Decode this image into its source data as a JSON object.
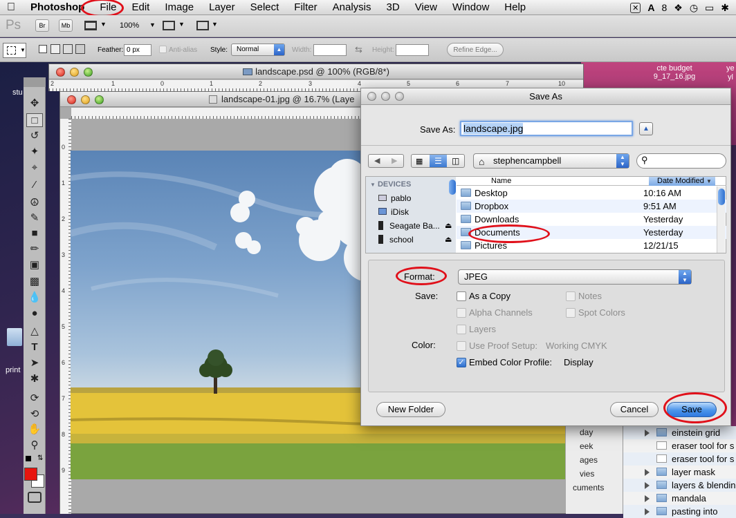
{
  "menubar": {
    "app": "Photoshop",
    "items": [
      "File",
      "Edit",
      "Image",
      "Layer",
      "Select",
      "Filter",
      "Analysis",
      "3D",
      "View",
      "Window",
      "Help"
    ],
    "status": "8"
  },
  "optbar1": {
    "ps_logo": "Ps",
    "br": "Br",
    "mb": "Mb",
    "zoom": "100%"
  },
  "optbar2": {
    "feather_label": "Feather:",
    "feather_value": "0 px",
    "antialias": "Anti-alias",
    "style_label": "Style:",
    "style_value": "Normal",
    "width_label": "Width:",
    "height_label": "Height:",
    "refine_edge": "Refine Edge..."
  },
  "desktop": {
    "icon1_label_line1": "cte budget",
    "icon1_label_line2": "9_17_16.jpg",
    "icon2_label": "ye",
    "icon3_label": "yl",
    "left_label1": "stu",
    "left_label2": "print"
  },
  "window_back": {
    "title": "landscape.psd @ 100% (RGB/8*)",
    "ruler": [
      "2",
      "1",
      "0",
      "1",
      "2",
      "3",
      "4",
      "5",
      "6",
      "7",
      "8",
      "9",
      "10"
    ]
  },
  "window_front": {
    "title": "landscape-01.jpg @ 16.7% (Laye",
    "ruler_left": [
      "0",
      "1",
      "2",
      "3",
      "4",
      "5",
      "6",
      "7",
      "8",
      "9"
    ]
  },
  "dialog": {
    "title": "Save As",
    "save_as_label": "Save As:",
    "filename": "landscape.jpg",
    "location": "stephencampbell",
    "sidebar_header": "DEVICES",
    "devices": [
      "pablo",
      "iDisk",
      "Seagate Ba...",
      "school"
    ],
    "col_name": "Name",
    "col_date": "Date Modified",
    "files": [
      {
        "name": "Desktop",
        "date": "10:16 AM"
      },
      {
        "name": "Dropbox",
        "date": "9:51 AM"
      },
      {
        "name": "Downloads",
        "date": "Yesterday"
      },
      {
        "name": "Documents",
        "date": "Yesterday"
      },
      {
        "name": "Pictures",
        "date": "12/21/15"
      }
    ],
    "format_label": "Format:",
    "format_value": "JPEG",
    "save_label": "Save:",
    "as_a_copy": "As a Copy",
    "notes": "Notes",
    "alpha_channels": "Alpha Channels",
    "spot_colors": "Spot Colors",
    "layers": "Layers",
    "color_label": "Color:",
    "use_proof_setup": "Use Proof Setup:",
    "working_cmyk": "Working CMYK",
    "embed_profile": "Embed Color Profile:",
    "display": "Display",
    "new_folder": "New Folder",
    "cancel": "Cancel",
    "save": "Save"
  },
  "background_list": {
    "left_items": [
      "day",
      "eek",
      "ages",
      "vies",
      "cuments"
    ],
    "items": [
      "einstein grid",
      "eraser tool for s",
      "eraser tool for s",
      "layer mask",
      "layers & blendin",
      "mandala",
      "pasting into"
    ]
  },
  "colors": {
    "annotation": "#e0101a",
    "accent": "#3b7fe0",
    "foreground": "#e8150f"
  }
}
